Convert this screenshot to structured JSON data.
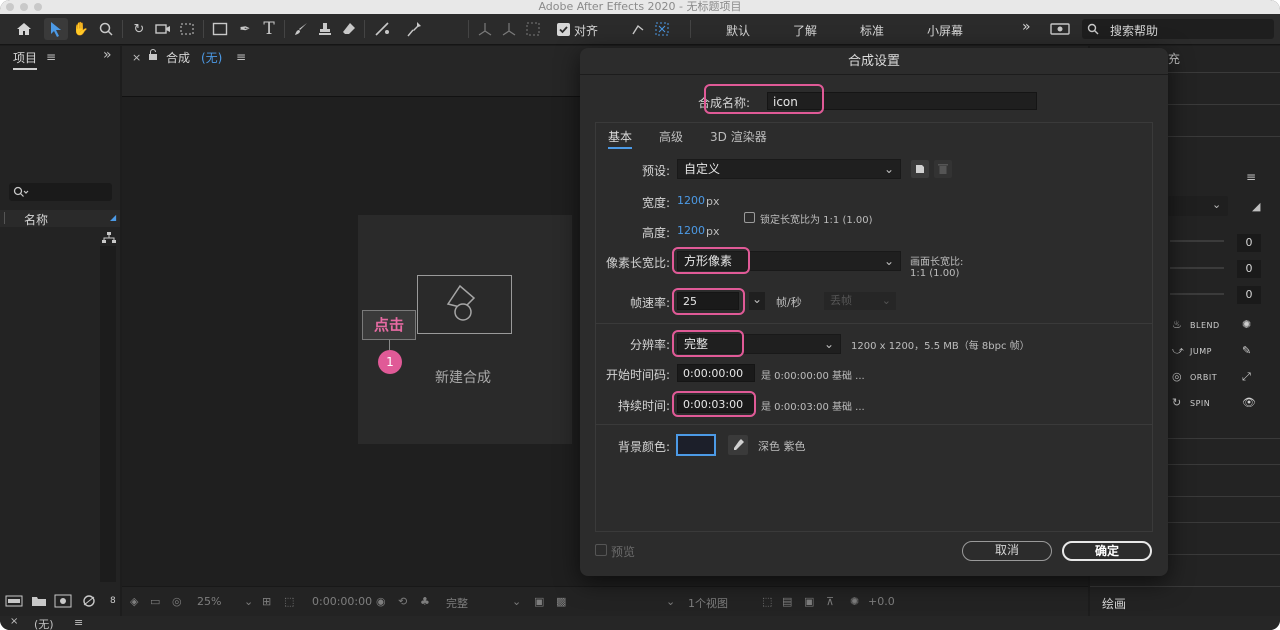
{
  "window": {
    "title": "Adobe After Effects 2020 - 无标题项目"
  },
  "toolbar": {
    "align_label": "对齐",
    "workspaces": [
      "默认",
      "了解",
      "标准",
      "小屏幕"
    ],
    "search_help": "搜索帮助"
  },
  "project_panel": {
    "tab": "项目",
    "search_placeholder": "",
    "column_name": "名称"
  },
  "comp_panel": {
    "tab_label": "合成",
    "tab_value": "(无)",
    "new_comp_label": "新建合成",
    "annotation_label": "点击",
    "annotation_number": "1"
  },
  "viewer_footer": {
    "zoom": "25%",
    "timecode": "0:00:00:00",
    "resolution": "完整",
    "views": "1个视图",
    "exposure": "+0.0",
    "bpc": "8"
  },
  "right_panel": {
    "values": [
      "0",
      "0",
      "0"
    ],
    "motion_labels": [
      "BLEND",
      "JUMP",
      "ORBIT",
      "SPIN"
    ],
    "paint_label": "绘画",
    "top_fragment": "充"
  },
  "bottom_bar": {
    "label": "(无)"
  },
  "dialog": {
    "title": "合成设置",
    "name_label": "合成名称:",
    "name_value": "icon",
    "tabs": [
      "基本",
      "高级",
      "3D 渲染器"
    ],
    "preset_label": "预设:",
    "preset_value": "自定义",
    "width_label": "宽度:",
    "width_value": "1200",
    "width_unit": "px",
    "height_label": "高度:",
    "height_value": "1200",
    "height_unit": "px",
    "lock_label": "锁定长宽比为 1:1 (1.00)",
    "pixel_aspect_label": "像素长宽比:",
    "pixel_aspect_value": "方形像素",
    "frame_aspect_label": "画面长宽比:",
    "frame_aspect_value": "1:1 (1.00)",
    "fps_label": "帧速率:",
    "fps_value": "25",
    "fps_unit": "帧/秒",
    "drop_frame": "丢帧",
    "resolution_label": "分辨率:",
    "resolution_value": "完整",
    "resolution_info": "1200 x 1200，5.5 MB（每 8bpc 帧）",
    "start_tc_label": "开始时间码:",
    "start_tc_value": "0:00:00:00",
    "start_tc_info": "是 0:00:00:00  基础 ...",
    "duration_label": "持续时间:",
    "duration_value": "0:00:03:00",
    "duration_info": "是 0:00:03:00  基础 ...",
    "bg_label": "背景颜色:",
    "bg_name": "深色 紫色",
    "bg_color": "#1c1f2a",
    "preview_label": "预览",
    "cancel": "取消",
    "ok": "确定"
  },
  "colors": {
    "accent": "#4c9ae6",
    "highlight": "#e05a97"
  }
}
